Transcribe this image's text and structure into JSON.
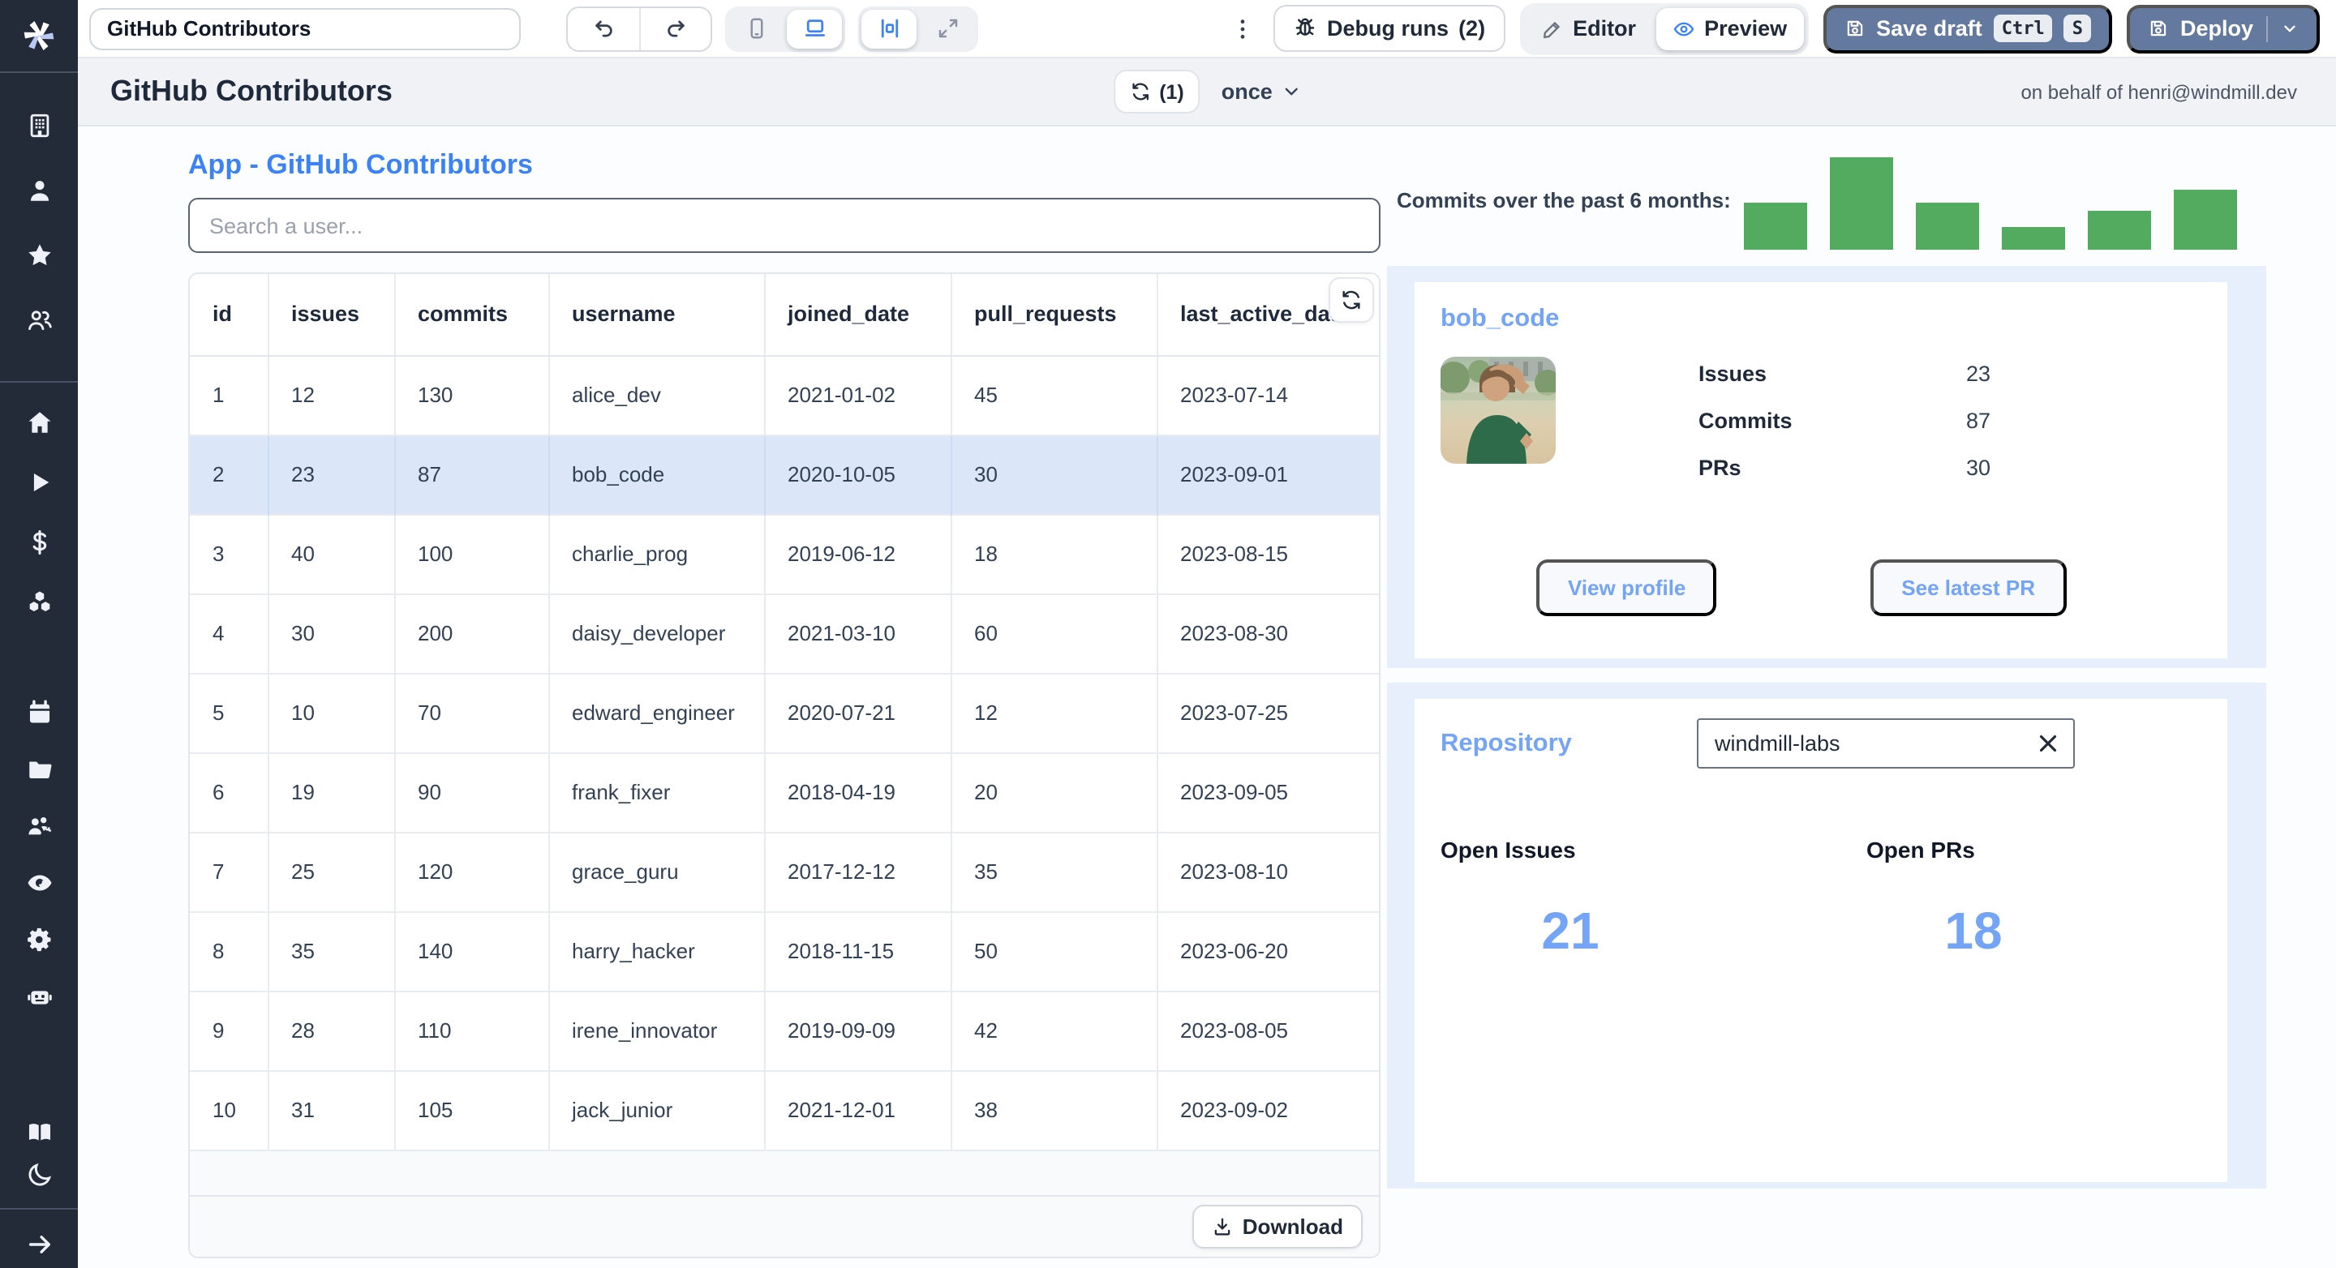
{
  "topbar": {
    "app_title_value": "GitHub Contributors",
    "debug_label": "Debug runs",
    "debug_count": "(2)",
    "editor_label": "Editor",
    "preview_label": "Preview",
    "save_label": "Save draft",
    "save_kbd": [
      "Ctrl",
      "S"
    ],
    "deploy_label": "Deploy"
  },
  "sidebar": {
    "groups": [
      [
        "building",
        "user",
        "star",
        "users"
      ],
      [
        "home",
        "play",
        "dollar",
        "cubes"
      ],
      [
        "calendar",
        "folder",
        "team-settings",
        "eye",
        "gear",
        "robot"
      ],
      [
        "book",
        "moon"
      ],
      [
        "collapse-arrow"
      ]
    ]
  },
  "app_header": {
    "title": "GitHub Contributors",
    "refresh_count": "(1)",
    "schedule": "once",
    "on_behalf": "on behalf of henri@windmill.dev"
  },
  "main": {
    "section_title": "App - GitHub Contributors",
    "search_placeholder": "Search a user...",
    "table": {
      "columns": [
        "id",
        "issues",
        "commits",
        "username",
        "joined_date",
        "pull_requests",
        "last_active_date"
      ],
      "rows": [
        [
          1,
          12,
          130,
          "alice_dev",
          "2021-01-02",
          45,
          "2023-07-14"
        ],
        [
          2,
          23,
          87,
          "bob_code",
          "2020-10-05",
          30,
          "2023-09-01"
        ],
        [
          3,
          40,
          100,
          "charlie_prog",
          "2019-06-12",
          18,
          "2023-08-15"
        ],
        [
          4,
          30,
          200,
          "daisy_developer",
          "2021-03-10",
          60,
          "2023-08-30"
        ],
        [
          5,
          10,
          70,
          "edward_engineer",
          "2020-07-21",
          12,
          "2023-07-25"
        ],
        [
          6,
          19,
          90,
          "frank_fixer",
          "2018-04-19",
          20,
          "2023-09-05"
        ],
        [
          7,
          25,
          120,
          "grace_guru",
          "2017-12-12",
          35,
          "2023-08-10"
        ],
        [
          8,
          35,
          140,
          "harry_hacker",
          "2018-11-15",
          50,
          "2023-06-20"
        ],
        [
          9,
          28,
          110,
          "irene_innovator",
          "2019-09-09",
          42,
          "2023-08-05"
        ],
        [
          10,
          31,
          105,
          "jack_junior",
          "2021-12-01",
          38,
          "2023-09-02"
        ]
      ],
      "selected_id": 2,
      "download_label": "Download"
    }
  },
  "chart_data": {
    "type": "bar",
    "title": "Commits over the past 6 months:",
    "categories": [
      "",
      "",
      "",
      "",
      "",
      ""
    ],
    "values": [
      50,
      100,
      50,
      25,
      42,
      65
    ],
    "ylim": [
      0,
      100
    ],
    "grid": false,
    "legend": "none",
    "color": "#52ab5e"
  },
  "user_card": {
    "name": "bob_code",
    "stats": [
      {
        "label": "Issues",
        "value": "23"
      },
      {
        "label": "Commits",
        "value": "87"
      },
      {
        "label": "PRs",
        "value": "30"
      }
    ],
    "view_profile_label": "View profile",
    "see_latest_pr_label": "See latest PR"
  },
  "repo_card": {
    "title": "Repository",
    "input_value": "windmill-labs",
    "open_issues_label": "Open Issues",
    "open_issues_value": "21",
    "open_prs_label": "Open PRs",
    "open_prs_value": "18"
  },
  "colors": {
    "accent": "#3b82f6",
    "accent_light": "#74a4f6",
    "bar_green": "#52ab5e",
    "selected_row": "#dbe7f8",
    "primary_button": "#64799e",
    "sidebar_bg": "#232a38"
  }
}
